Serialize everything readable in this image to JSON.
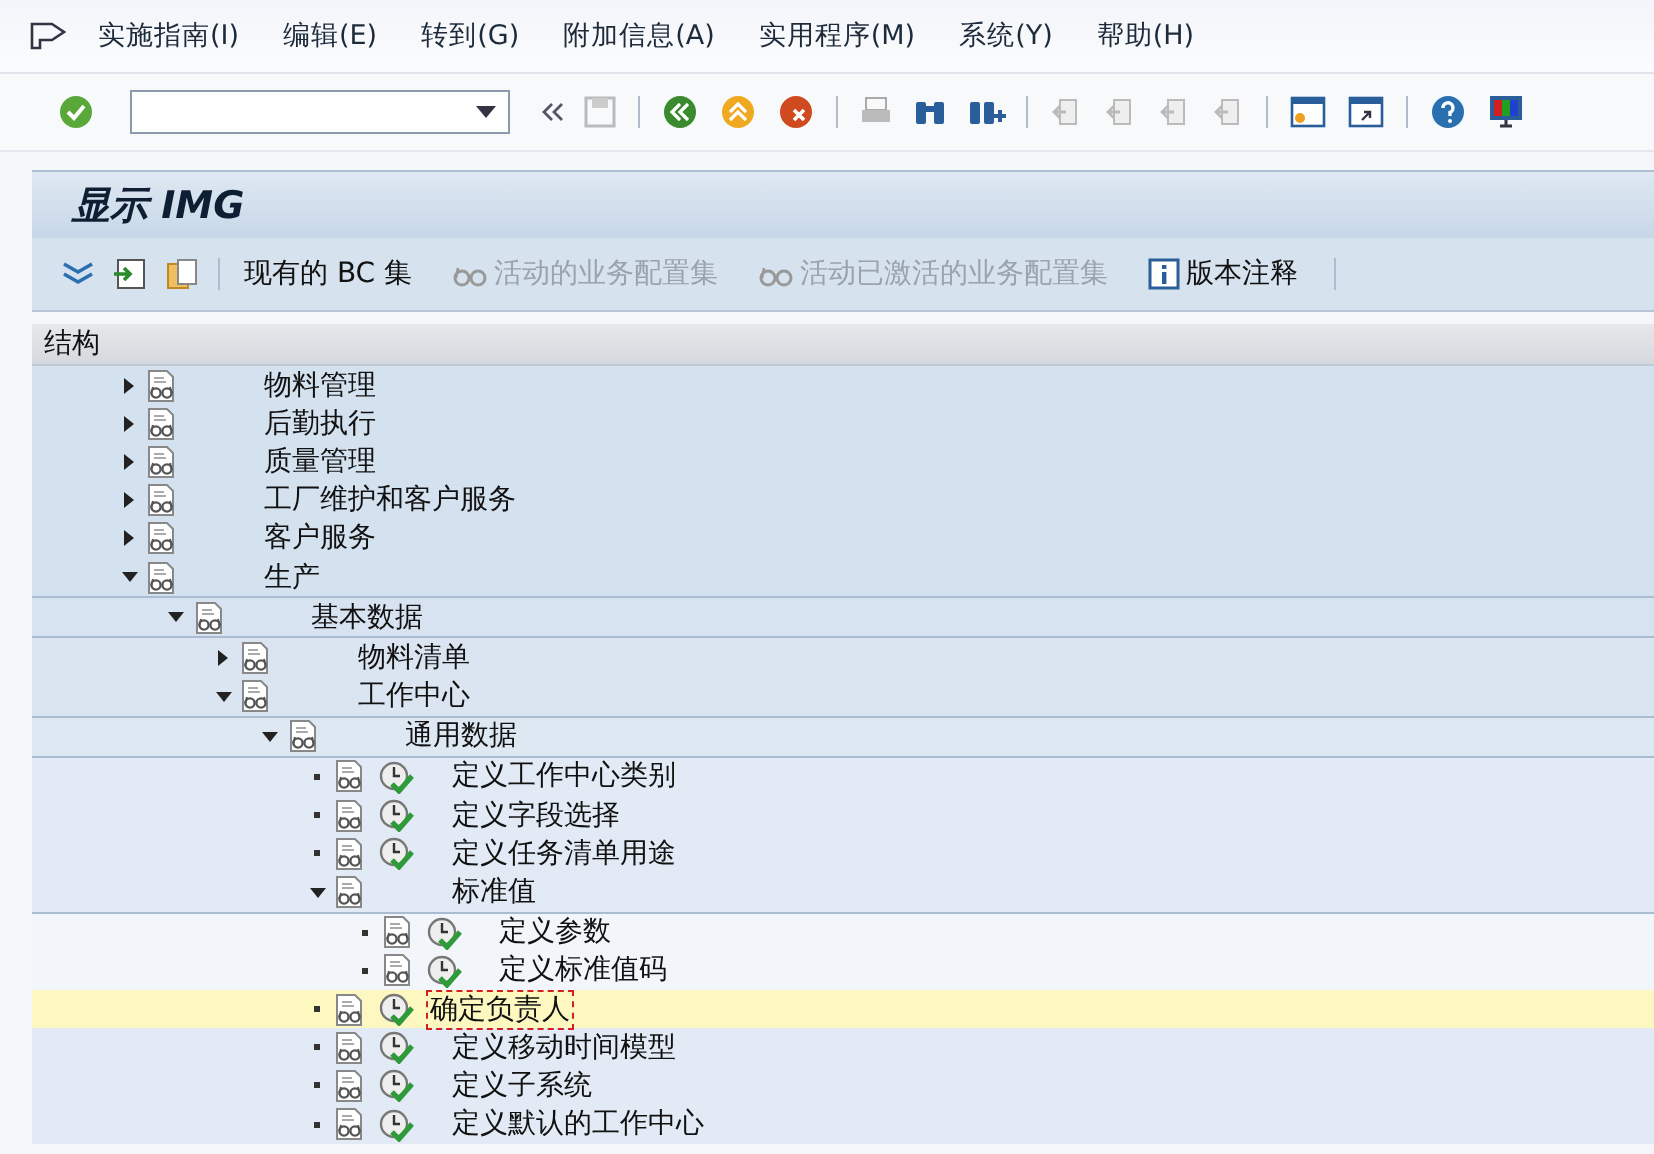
{
  "menu": [
    {
      "label": "实施指南(I)"
    },
    {
      "label": "编辑(E)"
    },
    {
      "label": "转到(G)"
    },
    {
      "label": "附加信息(A)"
    },
    {
      "label": "实用程序(M)"
    },
    {
      "label": "系统(Y)"
    },
    {
      "label": "帮助(H)"
    }
  ],
  "screen": {
    "title": "显示 IMG"
  },
  "app_toolbar": [
    {
      "kind": "expand",
      "disabled": false
    },
    {
      "kind": "plain",
      "label": "现有的 BC 集",
      "disabled": false
    },
    {
      "kind": "glasses",
      "label": "活动的业务配置集",
      "disabled": true
    },
    {
      "kind": "glasses",
      "label": "活动已激活的业务配置集",
      "disabled": true
    },
    {
      "kind": "info",
      "label": "版本注释",
      "disabled": false
    }
  ],
  "tree": {
    "header": "结构",
    "items": [
      {
        "kind": "folder",
        "label": "物料管理",
        "expanded": false,
        "selected": false
      },
      {
        "kind": "folder",
        "label": "后勤执行",
        "expanded": false,
        "selected": false
      },
      {
        "kind": "folder",
        "label": "质量管理",
        "expanded": false,
        "selected": false
      },
      {
        "kind": "folder",
        "label": "工厂维护和客户服务",
        "expanded": false,
        "selected": false
      },
      {
        "kind": "folder",
        "label": "客户服务",
        "expanded": false,
        "selected": false
      },
      {
        "kind": "folder",
        "label": "生产",
        "expanded": true,
        "selected": false,
        "children": [
          {
            "kind": "folder",
            "label": "基本数据",
            "expanded": true,
            "selected": false,
            "children": [
              {
                "kind": "folder",
                "label": "物料清单",
                "expanded": false,
                "selected": false
              },
              {
                "kind": "folder",
                "label": "工作中心",
                "expanded": true,
                "selected": false,
                "children": [
                  {
                    "kind": "folder",
                    "label": "通用数据",
                    "expanded": true,
                    "selected": false,
                    "children": [
                      {
                        "kind": "activity",
                        "label": "定义工作中心类别",
                        "selected": false
                      },
                      {
                        "kind": "activity",
                        "label": "定义字段选择",
                        "selected": false
                      },
                      {
                        "kind": "activity",
                        "label": "定义任务清单用途",
                        "selected": false
                      },
                      {
                        "kind": "folder",
                        "label": "标准值",
                        "expanded": true,
                        "selected": false,
                        "children": [
                          {
                            "kind": "activity",
                            "label": "定义参数",
                            "selected": false
                          },
                          {
                            "kind": "activity",
                            "label": "定义标准值码",
                            "selected": false
                          }
                        ]
                      },
                      {
                        "kind": "activity",
                        "label": "确定负责人",
                        "selected": true
                      },
                      {
                        "kind": "activity",
                        "label": "定义移动时间模型",
                        "selected": false
                      },
                      {
                        "kind": "activity",
                        "label": "定义子系统",
                        "selected": false
                      },
                      {
                        "kind": "activity",
                        "label": "定义默认的工作中心",
                        "selected": false
                      }
                    ]
                  }
                ]
              }
            ]
          }
        ]
      }
    ]
  }
}
